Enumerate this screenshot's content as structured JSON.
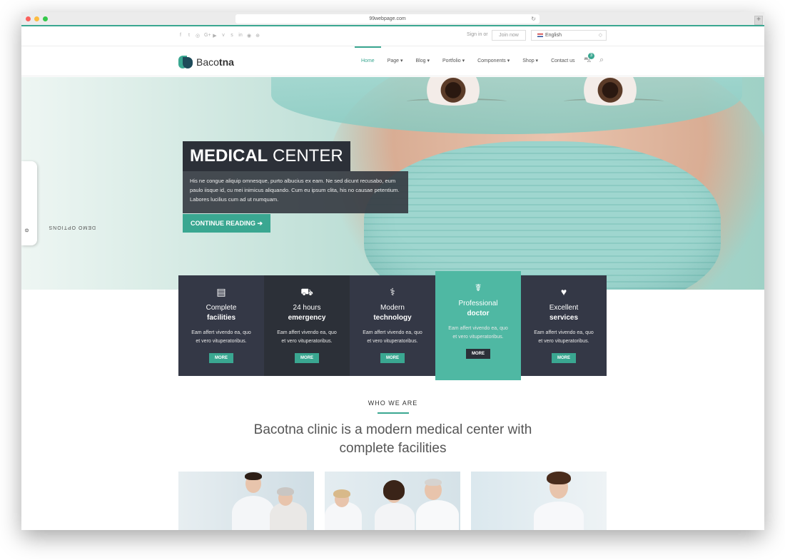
{
  "browser": {
    "url": "99webpage.com"
  },
  "topbar": {
    "social_icons": [
      "f",
      "t",
      "◎",
      "G+",
      "▶",
      "v",
      "s",
      "in",
      "◉",
      "⊕"
    ],
    "social_names": [
      "facebook-icon",
      "twitter-icon",
      "instagram-icon",
      "google-plus-icon",
      "youtube-icon",
      "vimeo-icon",
      "skype-icon",
      "linkedin-icon",
      "dribbble-icon",
      "pinterest-icon"
    ],
    "sign_in": "Sign in or",
    "join": "Join now",
    "language": "English"
  },
  "nav": {
    "logo_light": "Baco",
    "logo_bold": "tna",
    "items": [
      "Home",
      "Page ▾",
      "Blog ▾",
      "Portfolio ▾",
      "Components ▾",
      "Shop ▾",
      "Contact us"
    ],
    "cart_count": "3"
  },
  "hero": {
    "title_bold": "MEDICAL",
    "title_light": " CENTER",
    "description": "His ne congue aliquip omnesque, purto albucius ex eam. Ne sed dicunt recusabo, eum paulo iisque id, cu mei inimicus aliquando. Cum eu ipsum clita, his no causae petentium. Labores lucilius cum ad ut numquam.",
    "button": "CONTINUE READING ➔",
    "demo_options": "DEMO OPTIONS"
  },
  "features": [
    {
      "icon": "▤",
      "icon_name": "hospital-icon",
      "line1": "Complete",
      "line2": "facilities",
      "desc1": "Eam affert vivendo ea, quo",
      "desc2": "et vero vituperatoribus.",
      "more": "MORE"
    },
    {
      "icon": "⛟",
      "icon_name": "ambulance-icon",
      "line1": "24 hours",
      "line2": "emergency",
      "desc1": "Eam affert vivendo ea, quo",
      "desc2": "et vero vituperatoribus.",
      "more": "MORE"
    },
    {
      "icon": "⚕",
      "icon_name": "stethoscope-icon",
      "line1": "Modern",
      "line2": "technology",
      "desc1": "Eam affert vivendo ea, quo",
      "desc2": "et vero vituperatoribus.",
      "more": "MORE"
    },
    {
      "icon": "☤",
      "icon_name": "doctor-icon",
      "line1": "Professional",
      "line2": "doctor",
      "desc1": "Eam affert vivendo ea, quo",
      "desc2": "et vero vituperatoribus.",
      "more": "MORE"
    },
    {
      "icon": "♥",
      "icon_name": "heartbeat-icon",
      "line1": "Excellent",
      "line2": "services",
      "desc1": "Eam affert vivendo ea, quo",
      "desc2": "et vero vituperatoribus.",
      "more": "MORE"
    }
  ],
  "about": {
    "heading": "WHO WE ARE",
    "line1": "Bacotna clinic is a modern medical center with",
    "line2": "complete facilities"
  }
}
